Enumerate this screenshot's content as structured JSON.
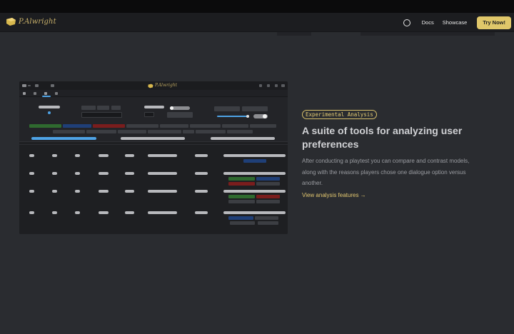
{
  "brand": {
    "name": "P.Alwright"
  },
  "nav": {
    "theme_icon": "circle-icon",
    "links": [
      "Docs",
      "Showcase"
    ],
    "cta_label": "Try Now!"
  },
  "preview": {
    "app_name": "P.Alwright"
  },
  "feature": {
    "badge": "Experimental Analysis",
    "headline": "A suite of tools for analyzing user preferences",
    "description": "After conducting a playtest you can compare and contrast models, along with the reasons players chose one dialogue option versus another.",
    "link_label": "View analysis features →"
  },
  "colors": {
    "accent": "#e0c76a",
    "background": "#2a2c30",
    "navbar": "#1c1d20"
  }
}
